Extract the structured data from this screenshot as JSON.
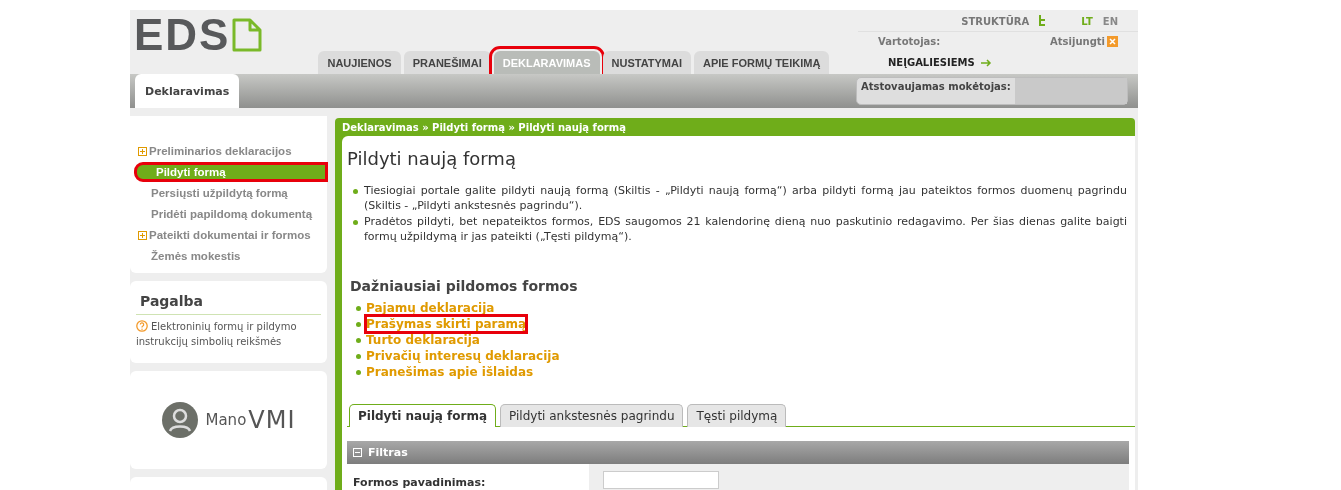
{
  "header": {
    "logo": "EDS",
    "structure_link": "STRUKTŪRA",
    "languages": [
      {
        "label": "LT",
        "selected": true
      },
      {
        "label": "EN",
        "selected": false
      }
    ],
    "user_label": "Vartotojas:",
    "logout": "Atsijungti",
    "accessibility": "NEĮGALIESIEMS"
  },
  "main_tabs": [
    {
      "label": "NAUJIENOS",
      "selected": false,
      "highlighted": false
    },
    {
      "label": "PRANEŠIMAI",
      "selected": false,
      "highlighted": false
    },
    {
      "label": "DEKLARAVIMAS",
      "selected": true,
      "highlighted": true
    },
    {
      "label": "NUSTATYMAI",
      "selected": false,
      "highlighted": false
    },
    {
      "label": "APIE FORMŲ TEIKIMĄ",
      "selected": false,
      "highlighted": false
    }
  ],
  "sub_tab": {
    "label": "Deklaravimas"
  },
  "payer": {
    "label": "Atstovaujamas mokėtojas:"
  },
  "sidebar": {
    "items": [
      {
        "label": "Preliminarios deklaracijos",
        "expandable": true,
        "selected": false,
        "highlighted": false
      },
      {
        "label": "Pildyti formą",
        "expandable": false,
        "selected": true,
        "highlighted": true
      },
      {
        "label": "Persiųsti užpildytą formą",
        "expandable": false,
        "selected": false,
        "highlighted": false
      },
      {
        "label": "Pridėti papildomą dokumentą",
        "expandable": false,
        "selected": false,
        "highlighted": false
      },
      {
        "label": "Pateikti dokumentai ir formos",
        "expandable": true,
        "selected": false,
        "highlighted": false
      },
      {
        "label": "Žemės mokestis",
        "expandable": false,
        "selected": false,
        "highlighted": false
      }
    ]
  },
  "help": {
    "title": "Pagalba",
    "text": "Elektroninių formų ir pildymo instrukcijų simbolių reikšmės"
  },
  "logo_box": {
    "text_1": "Mano",
    "text_2": "VMI"
  },
  "breadcrumb": "Deklaravimas » Pildyti formą » Pildyti naują formą",
  "page_title": "Pildyti naują formą",
  "info": [
    "Tiesiogiai portale galite pildyti naują formą (Skiltis - „Pildyti naują formą“) arba pildyti formą jau pateiktos formos duomenų pagrindu (Skiltis - „Pildyti ankstesnės pagrindu“).",
    "Pradėtos pildyti, bet nepateiktos formos, EDS saugomos 21 kalendorinę dieną nuo paskutinio redagavimo. Per šias dienas galite baigti formų užpildymą ir jas pateikti („Tęsti pildymą“)."
  ],
  "frequent": {
    "title": "Dažniausiai pildomos formos",
    "links": [
      {
        "label": "Pajamų deklaracija",
        "highlighted": false
      },
      {
        "label": "Prašymas skirti paramą",
        "highlighted": true
      },
      {
        "label": "Turto deklaracija",
        "highlighted": false
      },
      {
        "label": "Privačių interesų deklaracija",
        "highlighted": false
      },
      {
        "label": "Pranešimas apie išlaidas",
        "highlighted": false
      }
    ]
  },
  "form_tabs": [
    {
      "label": "Pildyti naują formą",
      "selected": true
    },
    {
      "label": "Pildyti ankstesnės pagrindu",
      "selected": false
    },
    {
      "label": "Tęsti pildymą",
      "selected": false
    }
  ],
  "filter": {
    "title": "Filtras",
    "fields": [
      {
        "label": "Formos pavadinimas:"
      }
    ]
  }
}
